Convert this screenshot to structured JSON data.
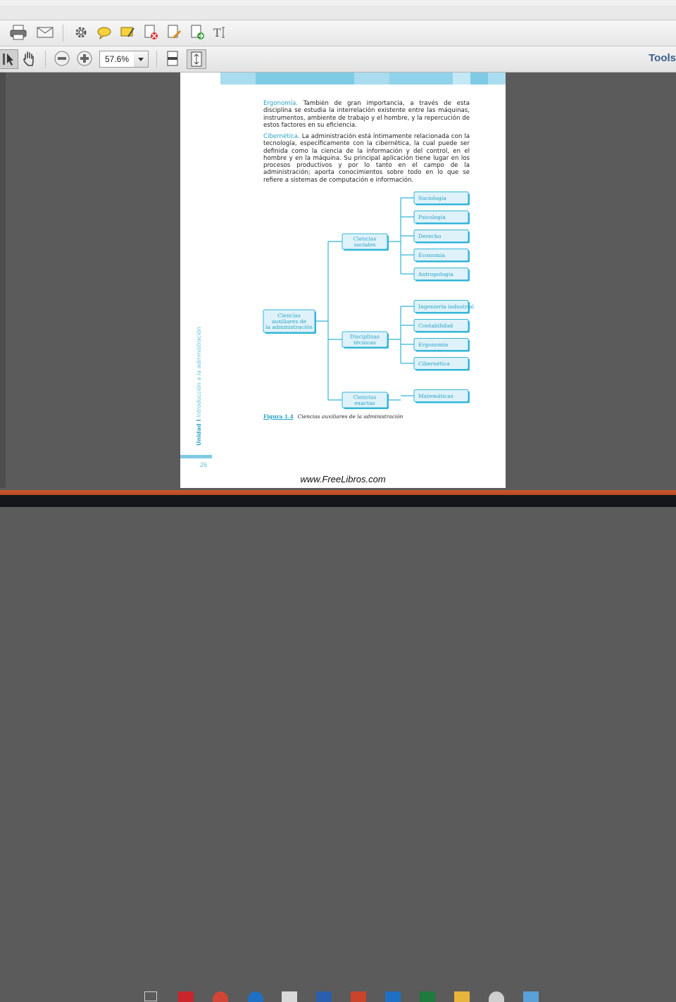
{
  "toolbar": {
    "zoom_value": "57.6%",
    "tools_label": "Tools"
  },
  "document": {
    "paragraphs": [
      {
        "term": "Ergonomía.",
        "text": " También de gran importancia, a través de esta disciplina se estudia la interrelación existente entre las máquinas, instrumentos, ambiente de trabajo y el hombre, y la repercución de estos factores en su eficiencia."
      },
      {
        "term": "Cibernética.",
        "text": " La administración está íntimamente relacionada con la tecnología, específicamente con la cibernética, la cual puede ser definida como la ciencia de la información y del control, en el hombre y en la máquina. Su principal aplicación tiene lugar en los procesos productivos y por lo tanto en el campo de la administración; aporta conocimientos sobre todo en lo que se refiere a sistemas de computación e información."
      }
    ],
    "diagram": {
      "root": [
        "Ciencias",
        "auxiliares de",
        "la administración"
      ],
      "groups": [
        {
          "label": [
            "Ciencias",
            "sociales"
          ],
          "children": [
            "Sociología",
            "Psicología",
            "Derecho",
            "Economía",
            "Antropología"
          ]
        },
        {
          "label": [
            "Disciplinas",
            "técnicas"
          ],
          "children": [
            "Ingeniería industrial",
            "Contabilidad",
            "Ergonomía",
            "Cibernética"
          ]
        },
        {
          "label": [
            "Ciencias",
            "exactas"
          ],
          "children": [
            "Matemáticas"
          ]
        }
      ]
    },
    "caption_fig": "Figura 1.4",
    "caption_text": "Ciencias auxiliares de la administración",
    "side_unit": "Unidad I",
    "side_title": "Introducción a la administración",
    "page_number": "26",
    "footer_url": "www.FreeLibros.com"
  },
  "colors": {
    "accent": "#26a2c5",
    "box_fill": "#dff2fa",
    "box_border": "#33b5d8"
  }
}
